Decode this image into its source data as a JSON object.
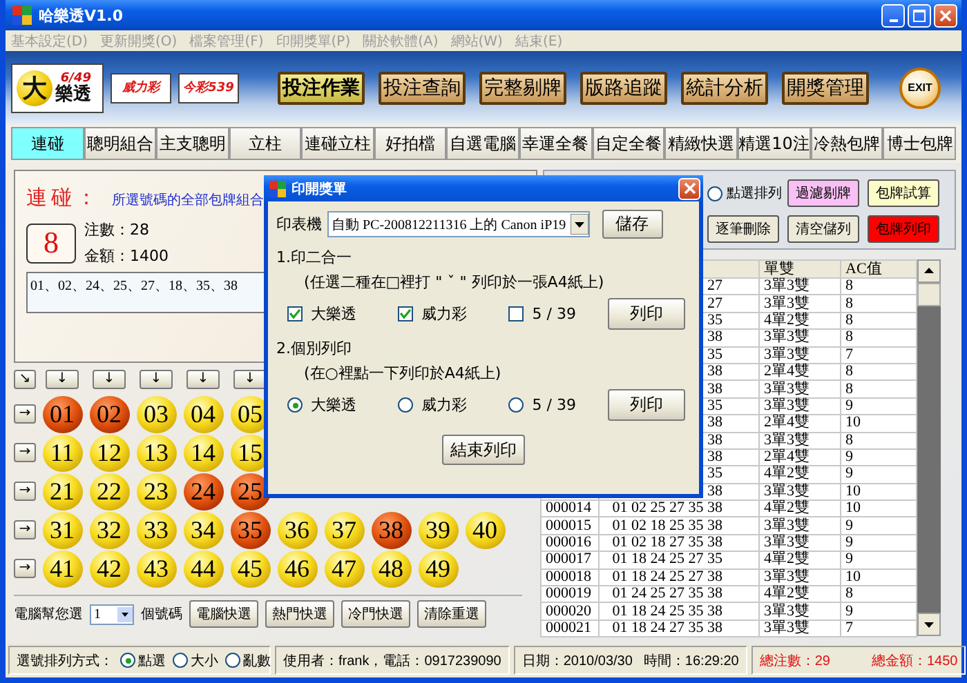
{
  "window": {
    "title": "哈樂透V1.0"
  },
  "menu": [
    {
      "label": "基本設定(D)",
      "disabled": true
    },
    {
      "label": "更新開獎(O)",
      "disabled": true
    },
    {
      "label": "檔案管理(F)",
      "disabled": true
    },
    {
      "label": "印開獎單(P)",
      "disabled": true
    },
    {
      "label": "關於軟體(A)",
      "disabled": true
    },
    {
      "label": "網站(W)",
      "disabled": true
    },
    {
      "label": "結束(E)",
      "disabled": true
    }
  ],
  "banner": {
    "logos": [
      {
        "kind": "lotto",
        "badge": "6/49",
        "mark": "大",
        "name": "樂透"
      },
      {
        "kind": "plain",
        "name": "威力彩"
      },
      {
        "kind": "plain",
        "name": "今彩539"
      }
    ],
    "nav": [
      {
        "label": "投注作業",
        "selected": true
      },
      {
        "label": "投注查詢",
        "selected": false
      },
      {
        "label": "完整剔牌",
        "selected": false
      },
      {
        "label": "版路追蹤",
        "selected": false
      },
      {
        "label": "統計分析",
        "selected": false
      },
      {
        "label": "開獎管理",
        "selected": false
      }
    ],
    "exit": "EXIT"
  },
  "tabs": [
    {
      "label": "連碰",
      "selected": true
    },
    {
      "label": "聰明組合",
      "selected": false
    },
    {
      "label": "主支聰明",
      "selected": false
    },
    {
      "label": "立柱",
      "selected": false
    },
    {
      "label": "連碰立柱",
      "selected": false
    },
    {
      "label": "好拍檔",
      "selected": false
    },
    {
      "label": "自選電腦",
      "selected": false
    },
    {
      "label": "幸運全餐",
      "selected": false
    },
    {
      "label": "自定全餐",
      "selected": false
    },
    {
      "label": "精緻快選",
      "selected": false
    },
    {
      "label": "精選10注",
      "selected": false
    },
    {
      "label": "冷熱包牌",
      "selected": false
    },
    {
      "label": "博士包牌",
      "selected": false
    }
  ],
  "info": {
    "title": "連碰：",
    "description": "所選號碼的全部包牌組合",
    "count": "8",
    "bets": "注數：28",
    "amount": "金額：1400",
    "numbers": "01、02、24、25、27、18、35、38"
  },
  "board": {
    "corner_arrow": "↘",
    "column_arrows": [
      "↓",
      "↓",
      "↓",
      "↓",
      "↓"
    ],
    "rows": [
      {
        "arrow": "→",
        "balls": [
          {
            "number": "01",
            "selected": true
          },
          {
            "number": "02",
            "selected": true
          },
          {
            "number": "03",
            "selected": false
          },
          {
            "number": "04",
            "selected": false
          },
          {
            "number": "05",
            "selected": false
          }
        ]
      },
      {
        "arrow": "→",
        "balls": [
          {
            "number": "11",
            "selected": false
          },
          {
            "number": "12",
            "selected": false
          },
          {
            "number": "13",
            "selected": false
          },
          {
            "number": "14",
            "selected": false
          },
          {
            "number": "15",
            "selected": false
          }
        ]
      },
      {
        "arrow": "→",
        "balls": [
          {
            "number": "21",
            "selected": false
          },
          {
            "number": "22",
            "selected": false
          },
          {
            "number": "23",
            "selected": false
          },
          {
            "number": "24",
            "selected": true
          },
          {
            "number": "25",
            "selected": true
          }
        ]
      },
      {
        "arrow": "→",
        "balls": [
          {
            "number": "31",
            "selected": false
          },
          {
            "number": "32",
            "selected": false
          },
          {
            "number": "33",
            "selected": false
          },
          {
            "number": "34",
            "selected": false
          },
          {
            "number": "35",
            "selected": true
          },
          {
            "number": "36",
            "selected": false
          },
          {
            "number": "37",
            "selected": false
          },
          {
            "number": "38",
            "selected": true
          },
          {
            "number": "39",
            "selected": false
          },
          {
            "number": "40",
            "selected": false
          }
        ]
      },
      {
        "arrow": "→",
        "balls": [
          {
            "number": "41",
            "selected": false
          },
          {
            "number": "42",
            "selected": false
          },
          {
            "number": "43",
            "selected": false
          },
          {
            "number": "44",
            "selected": false
          },
          {
            "number": "45",
            "selected": false
          },
          {
            "number": "46",
            "selected": false
          },
          {
            "number": "47",
            "selected": false
          },
          {
            "number": "48",
            "selected": false
          },
          {
            "number": "49",
            "selected": false
          }
        ]
      }
    ]
  },
  "picker": {
    "label": "電腦幫您選",
    "count": "1",
    "unit": "個號碼",
    "buttons": [
      "電腦快選",
      "熱門快選",
      "冷門快選",
      "清除重選"
    ]
  },
  "actions": {
    "sort_option": {
      "label": "點選排列",
      "selected": false
    },
    "buttons": [
      {
        "label": "過濾剔牌",
        "color": "#f8c0f4"
      },
      {
        "label": "包牌試算",
        "color": "#fcfcc8"
      },
      {
        "label": "逐筆刪除",
        "color": "#ece9d8"
      },
      {
        "label": "清空儲列",
        "color": "#ece9d8"
      },
      {
        "label": "包牌列印",
        "color": "#ff0000"
      }
    ]
  },
  "table": {
    "columns": [
      "單雙",
      "AC值"
    ],
    "rows": [
      {
        "numbers": "27",
        "parity": "3單3雙",
        "ac": "8"
      },
      {
        "numbers": "27",
        "parity": "3單3雙",
        "ac": "8"
      },
      {
        "numbers": "35",
        "parity": "4單2雙",
        "ac": "8"
      },
      {
        "numbers": "38",
        "parity": "3單3雙",
        "ac": "8"
      },
      {
        "numbers": "35",
        "parity": "3單3雙",
        "ac": "7"
      },
      {
        "numbers": "38",
        "parity": "2單4雙",
        "ac": "8"
      },
      {
        "numbers": "38",
        "parity": "3單3雙",
        "ac": "8"
      },
      {
        "numbers": "35",
        "parity": "3單3雙",
        "ac": "9"
      },
      {
        "numbers": "38",
        "parity": "2單4雙",
        "ac": "10"
      },
      {
        "numbers": "38",
        "parity": "3單3雙",
        "ac": "8"
      },
      {
        "numbers": "38",
        "parity": "2單4雙",
        "ac": "9"
      },
      {
        "numbers": "35",
        "parity": "4單2雙",
        "ac": "9"
      },
      {
        "numbers": "38",
        "parity": "3單3雙",
        "ac": "10"
      },
      {
        "id": "000014",
        "numbers": "01 02 25 27 35 38",
        "parity": "4單2雙",
        "ac": "10"
      },
      {
        "id": "000015",
        "numbers": "01 02 18 25 35 38",
        "parity": "3單3雙",
        "ac": "9"
      },
      {
        "id": "000016",
        "numbers": "01 02 18 27 35 38",
        "parity": "3單3雙",
        "ac": "9"
      },
      {
        "id": "000017",
        "numbers": "01 18 24 25 27 35",
        "parity": "4單2雙",
        "ac": "9"
      },
      {
        "id": "000018",
        "numbers": "01 18 24 25 27 38",
        "parity": "3單3雙",
        "ac": "10"
      },
      {
        "id": "000019",
        "numbers": "01 24 25 27 35 38",
        "parity": "4單2雙",
        "ac": "8"
      },
      {
        "id": "000020",
        "numbers": "01 18 24 25 35 38",
        "parity": "3單3雙",
        "ac": "9"
      },
      {
        "id": "000021",
        "numbers": "01 18 24 27 35 38",
        "parity": "3單3雙",
        "ac": "7"
      }
    ]
  },
  "status": {
    "sort_label": "選號排列方式：",
    "sort_options": [
      {
        "label": "點選",
        "selected": true
      },
      {
        "label": "大小",
        "selected": false
      },
      {
        "label": "亂數",
        "selected": false
      }
    ],
    "user": "使用者：frank，電話：0917239090",
    "date": "日期：2010/03/30",
    "time": "時間：16:29:20",
    "total_bets": "總注數：29",
    "total_amount": "總金額：1450"
  },
  "dialog": {
    "title": "印開獎單",
    "printer_label": "印表機",
    "printer": "自動 PC-200812211316 上的 Canon iP19",
    "save": "儲存",
    "section1": "1.印二合一",
    "hint1": "(任選二種在□裡打 \" ˇ \" 列印於一張A4紙上)",
    "checks": [
      {
        "label": "大樂透",
        "checked": true
      },
      {
        "label": "威力彩",
        "checked": true
      },
      {
        "label": "5 / 39",
        "checked": false
      }
    ],
    "print1": "列印",
    "section2": "2.個別列印",
    "hint2": "(在○裡點一下列印於A4紙上)",
    "radios": [
      {
        "label": "大樂透",
        "selected": true
      },
      {
        "label": "威力彩",
        "selected": false
      },
      {
        "label": "5 / 39",
        "selected": false
      }
    ],
    "print2": "列印",
    "close": "結束列印"
  }
}
